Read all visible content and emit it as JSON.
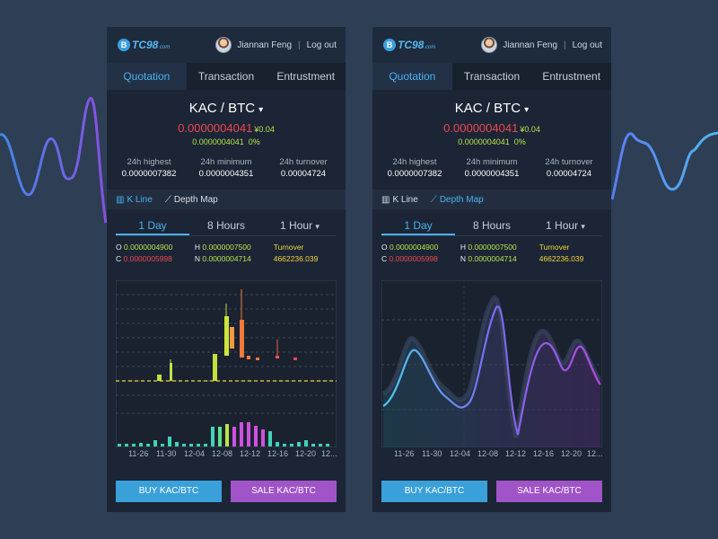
{
  "app": {
    "logo_mark": "B",
    "logo_text": "TC98",
    "logo_suffix": ".com"
  },
  "header": {
    "user_name": "Jiannan Feng",
    "logout_label": "Log out",
    "separator": "|"
  },
  "tabs": [
    {
      "label": "Quotation",
      "active": true
    },
    {
      "label": "Transaction",
      "active": false
    },
    {
      "label": "Entrustment",
      "active": false
    }
  ],
  "pair": {
    "label": "KAC / BTC",
    "caret": "▾"
  },
  "price": {
    "main": "0.0000004041",
    "rmb": "¥0.04",
    "change": "0.0000004041",
    "change_pct": "0%"
  },
  "stats": [
    {
      "label": "24h highest",
      "value": "0.0000007382"
    },
    {
      "label": "24h minimum",
      "value": "0.0000004351"
    },
    {
      "label": "24h turnover",
      "value": "0.00004724"
    }
  ],
  "chart_modes": [
    {
      "label": "K Line",
      "icon": "bar-chart-icon"
    },
    {
      "label": "Depth Map",
      "icon": "trend-line-icon"
    }
  ],
  "timeframes": [
    {
      "label": "1 Day",
      "active": true
    },
    {
      "label": "8 Hours",
      "active": false
    },
    {
      "label": "1 Hour",
      "active": false,
      "caret": "▾"
    }
  ],
  "ohlc": {
    "o_label": "O",
    "o_value": "0.0000004900",
    "c_label": "C",
    "c_value": "0.0000005998",
    "h_label": "H",
    "h_value": "0.0000007500",
    "n_label": "N",
    "n_value": "0.0000004714",
    "turnover_label": "Turnover",
    "turnover_value": "4662236.039"
  },
  "x_axis_labels": [
    "11-26",
    "11-30",
    "12-04",
    "12-08",
    "12-12",
    "12-16",
    "12-20",
    "12..."
  ],
  "actions": {
    "buy_label": "BUY KAC/BTC",
    "sale_label": "SALE KAC/BTC"
  },
  "colors": {
    "background": "#2d3e55",
    "panel": "#1b2535",
    "accent": "#4cb1ef",
    "price_down": "#f0474e",
    "price_up": "#b8e34a",
    "turnover": "#f5d33a",
    "buy": "#3aa0d9",
    "sale": "#a054c7"
  },
  "screens": [
    {
      "active_chart_mode": "K Line"
    },
    {
      "active_chart_mode": "Depth Map"
    }
  ]
}
